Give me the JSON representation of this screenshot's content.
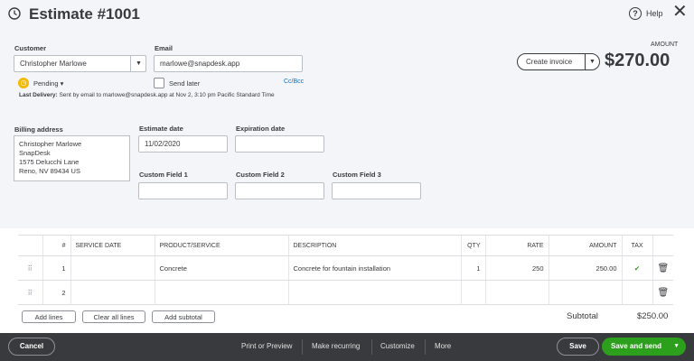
{
  "header": {
    "title": "Estimate #1001",
    "help": "Help",
    "amount_label": "AMOUNT",
    "amount": "$270.00",
    "create_invoice": "Create invoice"
  },
  "customer": {
    "label": "Customer",
    "value": "Christopher Marlowe",
    "status": "Pending"
  },
  "email": {
    "label": "Email",
    "value": "marlowe@snapdesk.app",
    "send_later": "Send later",
    "cc_bcc": "Cc/Bcc"
  },
  "last_delivery": {
    "label": "Last Delivery:",
    "text": "Sent by email to marlowe@snapdesk.app at Nov 2, 3:10 pm Pacific Standard Time"
  },
  "billing": {
    "label": "Billing address",
    "lines": [
      "Christopher Marlowe",
      "SnapDesk",
      "1575 Delucchi Lane",
      "Reno, NV  89434 US"
    ]
  },
  "estimate_date": {
    "label": "Estimate date",
    "value": "11/02/2020"
  },
  "expiration_date": {
    "label": "Expiration date",
    "value": ""
  },
  "custom_fields": [
    {
      "label": "Custom Field 1",
      "value": ""
    },
    {
      "label": "Custom Field 2",
      "value": ""
    },
    {
      "label": "Custom Field 3",
      "value": ""
    }
  ],
  "table": {
    "columns": [
      "#",
      "SERVICE DATE",
      "PRODUCT/SERVICE",
      "DESCRIPTION",
      "QTY",
      "RATE",
      "AMOUNT",
      "TAX"
    ],
    "rows": [
      {
        "num": "1",
        "date": "",
        "product": "Concrete",
        "description": "Concrete for fountain installation",
        "qty": "1",
        "rate": "250",
        "amount": "250.00",
        "tax": "✔"
      },
      {
        "num": "2",
        "date": "",
        "product": "",
        "description": "",
        "qty": "",
        "rate": "",
        "amount": "",
        "tax": ""
      }
    ]
  },
  "actions": {
    "add_lines": "Add lines",
    "clear_lines": "Clear all lines",
    "add_subtotal": "Add subtotal",
    "subtotal_label": "Subtotal",
    "subtotal": "$250.00"
  },
  "footer": {
    "cancel": "Cancel",
    "print": "Print or Preview",
    "recurring": "Make recurring",
    "customize": "Customize",
    "more": "More",
    "save": "Save",
    "save_send": "Save and send"
  },
  "colors": {
    "green": "#2ca01c",
    "footer": "#393a3d",
    "link": "#0077c5",
    "pending": "#f5b800"
  }
}
